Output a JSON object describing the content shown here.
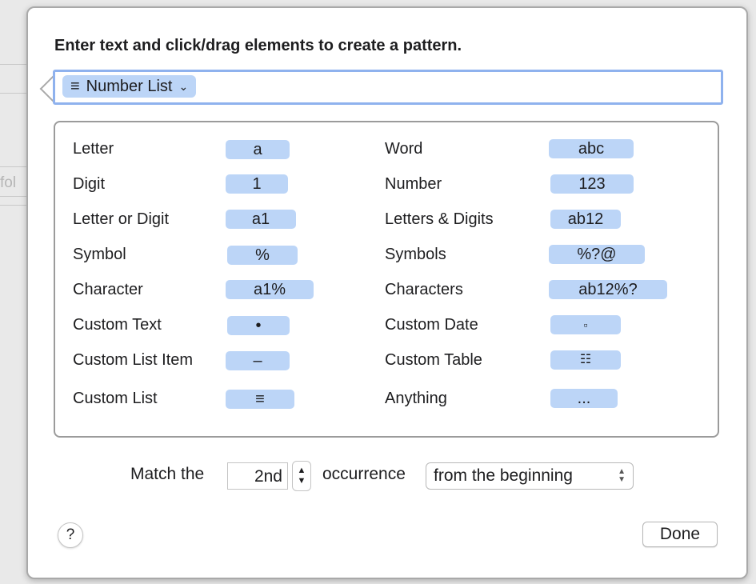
{
  "background": {
    "partial_text": "fol"
  },
  "popover": {
    "instruction": "Enter text and click/drag elements to create a pattern.",
    "pattern_token": {
      "icon": "≡",
      "label": "Number List",
      "chevron": "⌄"
    }
  },
  "elements": {
    "left": [
      {
        "label": "Letter",
        "token": "a"
      },
      {
        "label": "Digit",
        "token": "1"
      },
      {
        "label": "Letter or Digit",
        "token": "a1"
      },
      {
        "label": "Symbol",
        "token": "%"
      },
      {
        "label": "Character",
        "token": "a1%"
      },
      {
        "label": "Custom Text",
        "token": "•"
      },
      {
        "label": "Custom List Item",
        "token": "–"
      },
      {
        "label": "Custom List",
        "token": "≡"
      }
    ],
    "right": [
      {
        "label": "Word",
        "token": "abc"
      },
      {
        "label": "Number",
        "token": "123"
      },
      {
        "label": "Letters & Digits",
        "token": "ab12"
      },
      {
        "label": "Symbols",
        "token": "%?@"
      },
      {
        "label": "Characters",
        "token": "ab12%?"
      },
      {
        "label": "Custom Date",
        "token": "▫"
      },
      {
        "label": "Custom Table",
        "token": "☷"
      },
      {
        "label": "Anything",
        "token": "..."
      }
    ]
  },
  "match": {
    "prefix": "Match the",
    "ordinal": "2nd",
    "middle": "occurrence",
    "direction": "from the beginning"
  },
  "footer": {
    "help": "?",
    "done": "Done"
  }
}
